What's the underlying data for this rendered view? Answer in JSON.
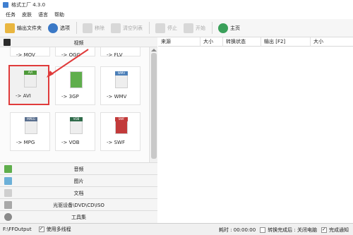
{
  "window": {
    "title": "格式工厂 4.3.0"
  },
  "menu": [
    "任务",
    "皮肤",
    "语言",
    "帮助"
  ],
  "toolbar": {
    "output_folder": "输出文件夹",
    "options": "选项",
    "remove": "移除",
    "clear_list": "清空列表",
    "stop": "停止",
    "start": "开始",
    "home": "主页"
  },
  "categories": {
    "video": "视频",
    "audio": "音频",
    "picture": "图片",
    "document": "文档",
    "rom": "光驱设备\\DVD\\CD\\ISO",
    "tools": "工具集"
  },
  "formats": {
    "row0": [
      "-> MOV",
      "-> OGG",
      "-> FLV"
    ],
    "row1": [
      "-> AVI",
      "-> 3GP",
      "-> WMV"
    ],
    "row2": [
      "-> MPG",
      "-> VOB",
      "-> SWF"
    ],
    "tags": [
      "AVI",
      "",
      "WMV",
      "MPEG",
      "VOB",
      "SWF"
    ]
  },
  "selected_format": "-> AVI",
  "columns": [
    "来源",
    "大小",
    "转换状态",
    "输出 [F2]",
    "大小"
  ],
  "status": {
    "output_path": "F:\\FFOutput",
    "multithread": "使用多线程",
    "elapsed_label": "耗时 : 00:00:00",
    "after_done": "转换完成后 : 关闭电脑",
    "notify": "完成通知"
  },
  "colors": {
    "accent": "#e03b3b",
    "avi_tag": "#4e9a3a",
    "wmv_tag": "#4b7fb8",
    "mpeg_tag": "#5a6f8e",
    "vob_tag": "#2f6b4a",
    "swf_tag": "#c23a3a"
  }
}
